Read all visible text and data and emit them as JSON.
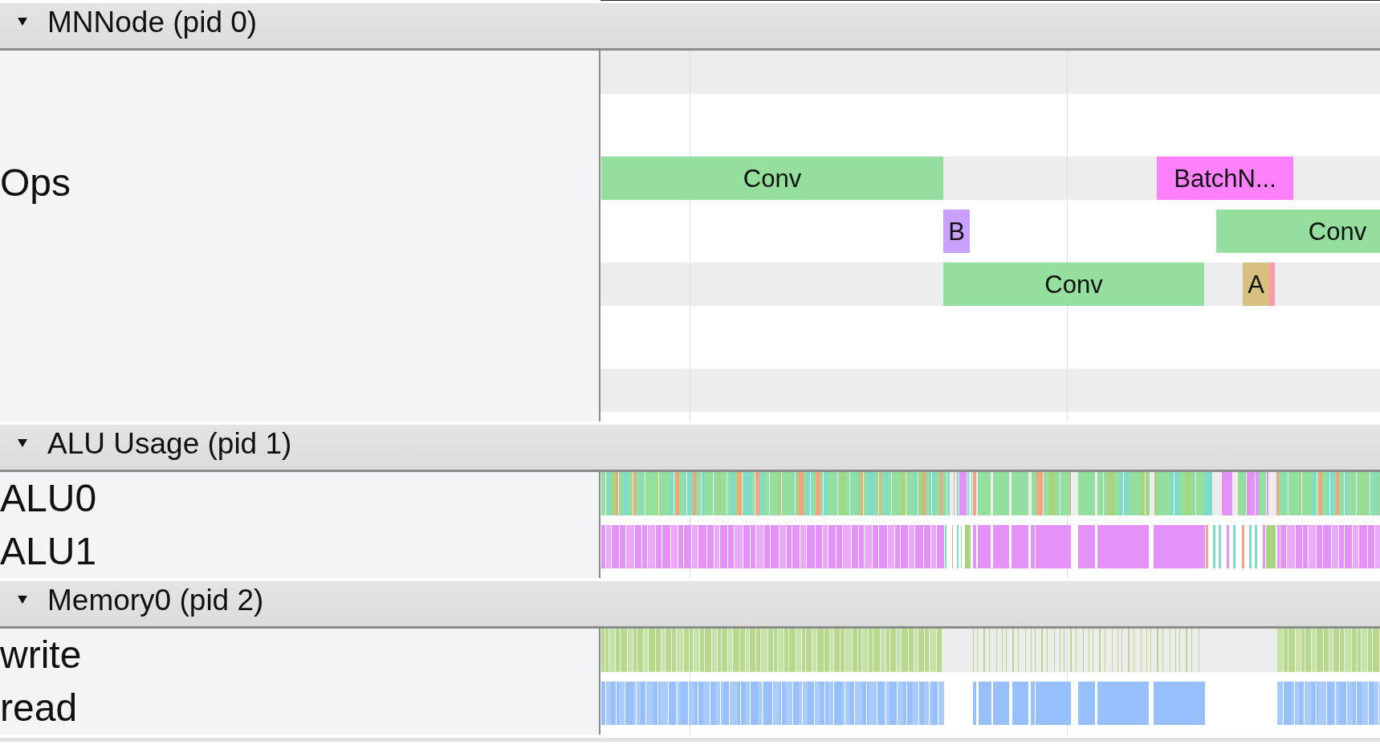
{
  "processes": [
    {
      "title": "MNNode (pid 0)",
      "expanded": true,
      "threads": [
        {
          "name": "Ops",
          "slices": [
            {
              "label": "Conv",
              "color": "#94df9e"
            },
            {
              "label": "BatchN...",
              "color": "#ff80fb"
            },
            {
              "label": "B",
              "color": "#c9a0ff"
            },
            {
              "label": "Conv",
              "color": "#94df9e"
            },
            {
              "label": "Conv",
              "color": "#94df9e"
            },
            {
              "label": "A",
              "color": "#d8c080"
            },
            {
              "color": "#ff9aa8"
            }
          ]
        }
      ]
    },
    {
      "title": "ALU Usage (pid 1)",
      "expanded": true,
      "threads": [
        {
          "name": "ALU0"
        },
        {
          "name": "ALU1"
        }
      ]
    },
    {
      "title": "Memory0 (pid 2)",
      "expanded": true,
      "threads": [
        {
          "name": "write"
        },
        {
          "name": "read"
        }
      ]
    }
  ]
}
